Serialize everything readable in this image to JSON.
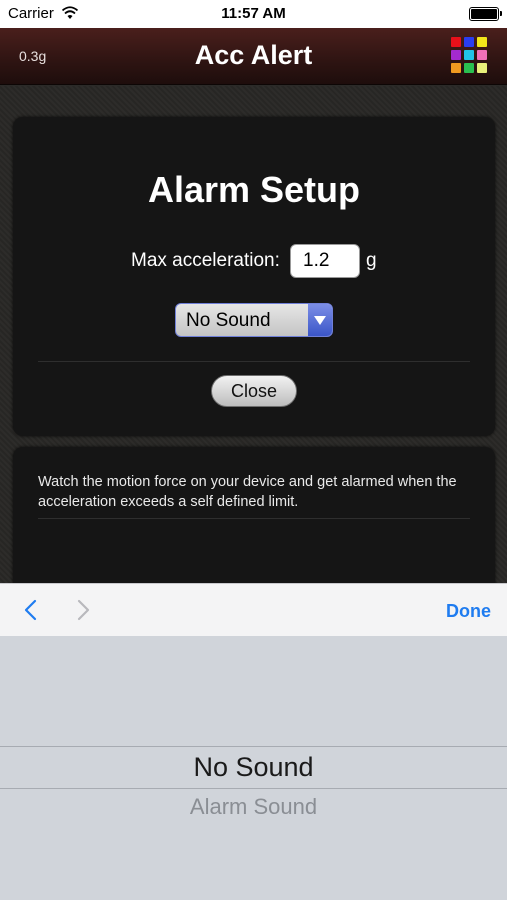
{
  "status_bar": {
    "carrier": "Carrier",
    "time": "11:57 AM"
  },
  "nav_bar": {
    "g_value": "0.3g",
    "title": "Acc Alert",
    "grid_colors": [
      "#e8101a",
      "#2a3df0",
      "#f2e61a",
      "#a42ad0",
      "#21c3e8",
      "#f070b8",
      "#f09a20",
      "#2ac050",
      "#e9f07a"
    ]
  },
  "alarm_setup": {
    "heading": "Alarm Setup",
    "max_label": "Max acceleration:",
    "max_value": "1.2",
    "unit": "g",
    "sound_selected": "No Sound",
    "close_label": "Close"
  },
  "info": {
    "description": "Watch the motion force on your device and get alarmed when the acceleration exceeds a self defined limit."
  },
  "toolbar": {
    "done_label": "Done"
  },
  "picker": {
    "options": [
      "No Sound",
      "Alarm Sound"
    ],
    "selected_index": 0
  },
  "colors": {
    "accent": "#1f7cf0",
    "nav_bg": "#3a1816",
    "card_bg": "#151515",
    "picker_bg": "#d0d4da"
  }
}
